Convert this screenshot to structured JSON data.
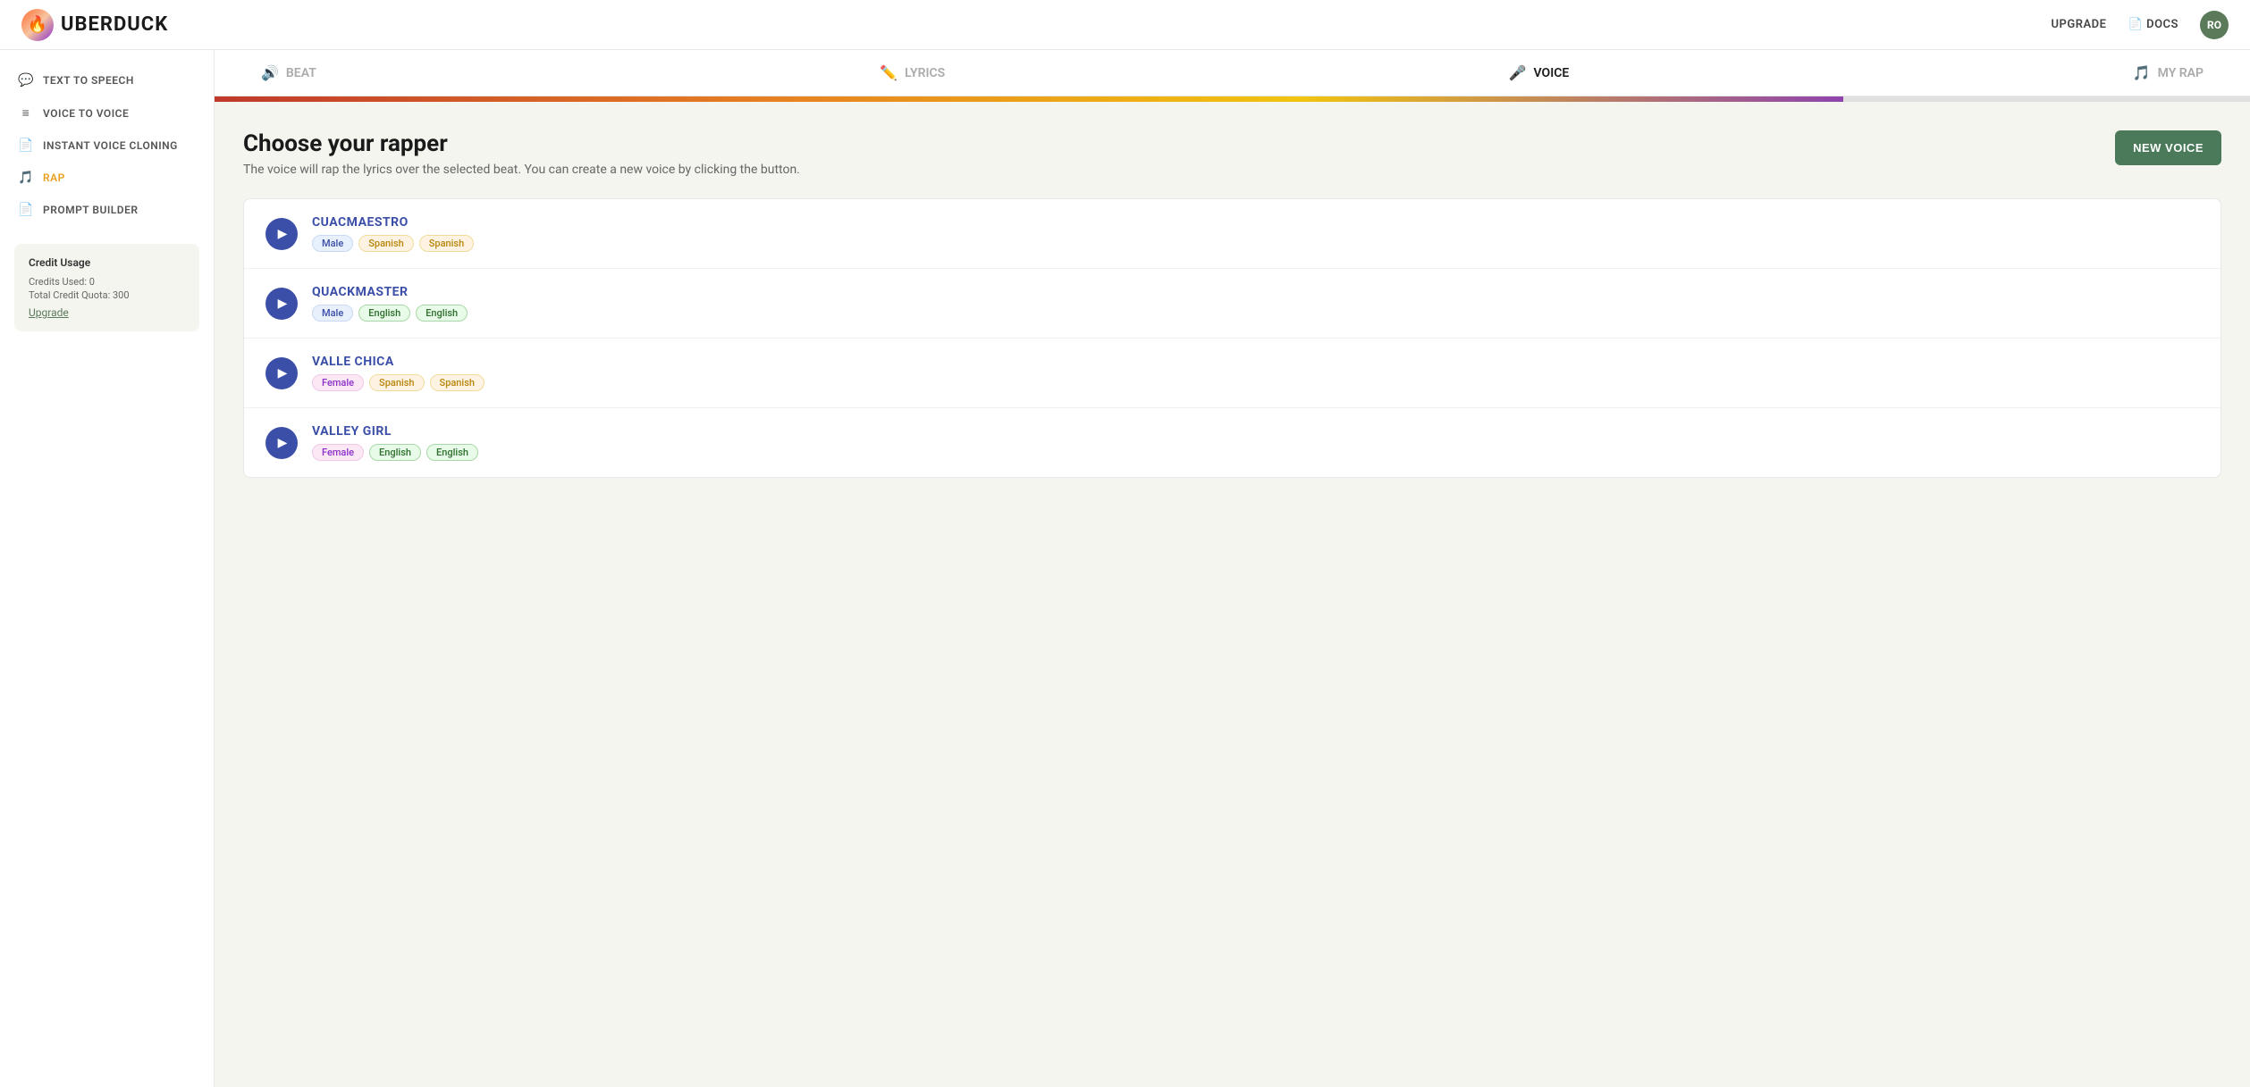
{
  "topnav": {
    "logo_icon": "🔥",
    "logo_text": "UBERDUCK",
    "upgrade_label": "UPGRADE",
    "docs_label": "DOCS",
    "docs_icon": "📄",
    "avatar_initials": "RO"
  },
  "sidebar": {
    "items": [
      {
        "id": "text-to-speech",
        "label": "TEXT TO SPEECH",
        "icon": "💬",
        "active": false
      },
      {
        "id": "voice-to-voice",
        "label": "VOICE TO VOICE",
        "icon": "≡",
        "active": false
      },
      {
        "id": "instant-voice-cloning",
        "label": "INSTANT VOICE CLONING",
        "icon": "📄",
        "active": false
      },
      {
        "id": "rap",
        "label": "RAP",
        "icon": "🎵",
        "active": true
      },
      {
        "id": "prompt-builder",
        "label": "PROMPT BUILDER",
        "icon": "📄",
        "active": false
      }
    ],
    "credit_usage": {
      "title": "Credit Usage",
      "credits_used_label": "Credits Used: 0",
      "total_quota_label": "Total Credit Quota: 300",
      "upgrade_label": "Upgrade"
    }
  },
  "steps": [
    {
      "id": "beat",
      "label": "BEAT",
      "icon": "🔊",
      "active": false
    },
    {
      "id": "lyrics",
      "label": "LYRICS",
      "icon": "✏️",
      "active": false
    },
    {
      "id": "voice",
      "label": "VOICE",
      "icon": "🎤",
      "active": true
    },
    {
      "id": "my-rap",
      "label": "MY RAP",
      "icon": "🎵",
      "active": false
    }
  ],
  "progress": {
    "percent": 80
  },
  "content": {
    "title": "Choose your rapper",
    "subtitle": "The voice will rap the lyrics over the selected beat. You can create a new voice by clicking the button.",
    "new_voice_label": "NEW VOICE"
  },
  "voices": [
    {
      "id": "cuacmaestro",
      "name": "CUACMAESTRO",
      "tags": [
        {
          "label": "Male",
          "type": "male"
        },
        {
          "label": "Spanish",
          "type": "spanish"
        },
        {
          "label": "Spanish",
          "type": "spanish"
        }
      ]
    },
    {
      "id": "quackmaster",
      "name": "QUACKMASTER",
      "tags": [
        {
          "label": "Male",
          "type": "male"
        },
        {
          "label": "English",
          "type": "english"
        },
        {
          "label": "English",
          "type": "english"
        }
      ]
    },
    {
      "id": "valle-chica",
      "name": "VALLE CHICA",
      "tags": [
        {
          "label": "Female",
          "type": "female"
        },
        {
          "label": "Spanish",
          "type": "spanish"
        },
        {
          "label": "Spanish",
          "type": "spanish"
        }
      ]
    },
    {
      "id": "valley-girl",
      "name": "VALLEY GIRL",
      "tags": [
        {
          "label": "Female",
          "type": "female"
        },
        {
          "label": "English",
          "type": "english"
        },
        {
          "label": "English",
          "type": "english"
        }
      ]
    }
  ]
}
